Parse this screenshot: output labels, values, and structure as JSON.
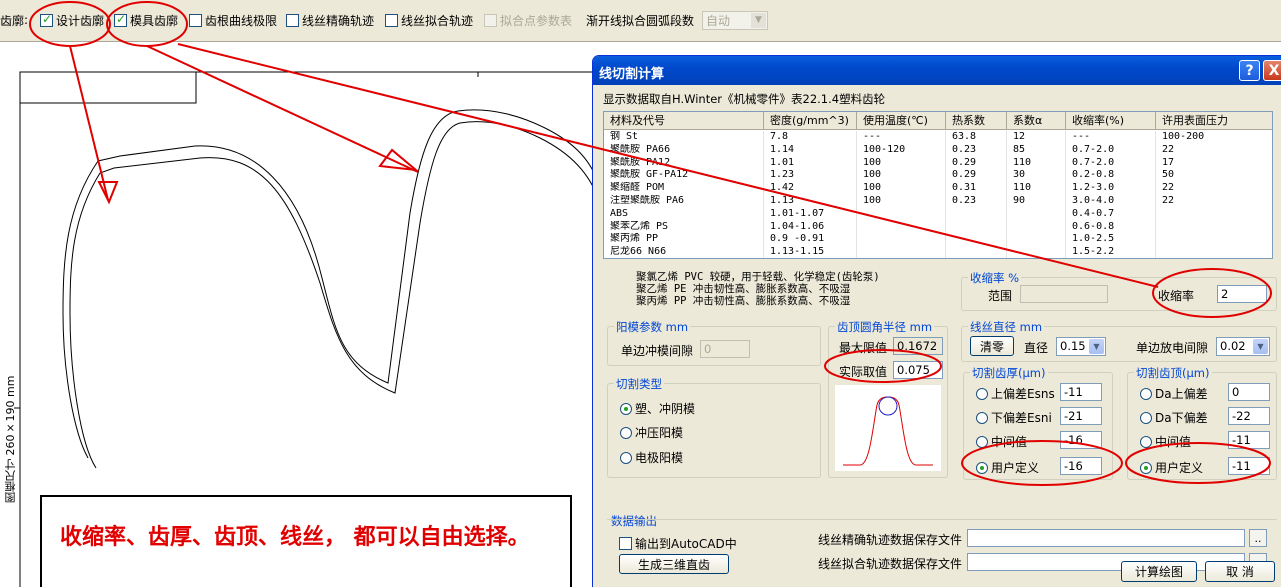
{
  "toolbar": {
    "cut_label": "齿廓",
    "design_profile": "设计齿廓",
    "mold_profile": "模具齿廓",
    "root_limit": "齿根曲线极限",
    "wire_exact": "线丝精确轨迹",
    "wire_fit": "线丝拟合轨迹",
    "fit_params": "拟合点参数表",
    "arc_segments_label": "渐开线拟合圆弧段数",
    "arc_segments_value": "自动"
  },
  "canvas": {
    "frame_size_label": "图框尺寸  260×190 mm",
    "note": "收缩率、齿厚、齿顶、线丝， 都可以自由选择。"
  },
  "dialog": {
    "title": "线切割计算",
    "help": "?",
    "close": "X",
    "source_note": "显示数据取自H.Winter《机械零件》表22.1.4塑料齿轮",
    "table": {
      "headers": [
        "材料及代号",
        "密度(g/mm^3)",
        "使用温度(℃)",
        "热系数",
        "系数α",
        "收缩率(%)",
        "许用表面压力"
      ],
      "rows": [
        [
          "钢 St",
          "7.8",
          "---",
          "63.8",
          "12",
          "---",
          "100-200"
        ],
        [
          "聚酰胺 PA66",
          "1.14",
          "100-120",
          "0.23",
          "85",
          "0.7-2.0",
          "22"
        ],
        [
          "聚酰胺 PA12",
          "1.01",
          "100",
          "0.29",
          "110",
          "0.7-2.0",
          "17"
        ],
        [
          "聚酰胺 GF-PA12",
          "1.23",
          "100",
          "0.29",
          "30",
          "0.2-0.8",
          "50"
        ],
        [
          "聚缩醛 POM",
          "1.42",
          "100",
          "0.31",
          "110",
          "1.2-3.0",
          "22"
        ],
        [
          "注塑聚酰胺 PA6",
          "1.13",
          "100",
          "0.23",
          "90",
          "3.0-4.0",
          "22"
        ],
        [
          "ABS",
          "1.01-1.07",
          "",
          "",
          "",
          "0.4-0.7",
          ""
        ],
        [
          "聚苯乙烯 PS",
          "1.04-1.06",
          "",
          "",
          "",
          "0.6-0.8",
          ""
        ],
        [
          "聚丙烯 PP",
          "0.9 -0.91",
          "",
          "",
          "",
          "1.0-2.5",
          ""
        ],
        [
          "尼龙66 N66",
          "1.13-1.15",
          "",
          "",
          "",
          "1.5-2.2",
          ""
        ]
      ]
    },
    "info_lines": [
      "聚氯乙烯 PVC    较硬，用于轻载、化学稳定(齿轮泵)",
      "聚乙烯 PE       冲击韧性高、膨胀系数高、不吸湿",
      "聚丙烯 PP       冲击韧性高、膨胀系数高、不吸湿"
    ],
    "shrink": {
      "title": "收缩率 %",
      "range_label": "范围",
      "range_value": "",
      "rate_label": "收缩率",
      "rate_value": "2"
    },
    "die": {
      "title": "阳模参数 mm",
      "gap_label": "单边冲模间隙",
      "gap_value": "0"
    },
    "tip_radius": {
      "title": "齿顶圆角半径 mm",
      "max_label": "最大限值",
      "max_value": "0.1672",
      "actual_label": "实际取值",
      "actual_value": "0.075"
    },
    "wire": {
      "title": "线丝直径 mm",
      "clear_button": "清零",
      "diameter_label": "直径",
      "diameter_value": "0.15",
      "gap_label": "单边放电间隙",
      "gap_value": "0.02"
    },
    "cut_type": {
      "title": "切割类型",
      "options": [
        "塑、冲阴模",
        "冲压阳模",
        "电极阳模"
      ],
      "selected": 0
    },
    "thickness": {
      "title": "切割齿厚(μm)",
      "rows": [
        {
          "label": "上偏差Esns",
          "value": "-11"
        },
        {
          "label": "下偏差Esni",
          "value": "-21"
        },
        {
          "label": "中间值",
          "value": "-16"
        },
        {
          "label": "用户定义",
          "value": "-16"
        }
      ],
      "selected": 3
    },
    "tip": {
      "title": "切割齿顶(μm)",
      "rows": [
        {
          "label": "Da上偏差",
          "value": "0"
        },
        {
          "label": "Da下偏差",
          "value": "-22"
        },
        {
          "label": "中间值",
          "value": "-11"
        },
        {
          "label": "用户定义",
          "value": "-11"
        }
      ],
      "selected": 3
    },
    "output": {
      "title": "数据输出",
      "autocad_label": "输出到AutoCAD中",
      "gen3d_button": "生成三维直齿",
      "exact_file_label": "线丝精确轨迹数据保存文件",
      "exact_file_value": "",
      "fit_file_label": "线丝拟合轨迹数据保存文件",
      "fit_file_value": "",
      "browse": ".."
    },
    "calc_button": "计算绘图",
    "cancel_button": "取 消"
  },
  "colors": {
    "annotation_red": "#e00000",
    "title_blue": "#0049cc",
    "group_title_blue": "#0046d5"
  }
}
